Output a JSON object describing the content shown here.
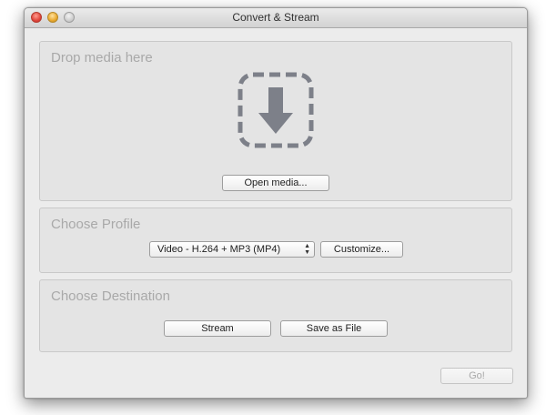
{
  "window": {
    "title": "Convert & Stream"
  },
  "drop_panel": {
    "title": "Drop media here",
    "icon": "download-arrow-icon",
    "open_button": "Open media..."
  },
  "profile_panel": {
    "title": "Choose Profile",
    "selected_profile": "Video - H.264 + MP3 (MP4)",
    "customize_button": "Customize..."
  },
  "destination_panel": {
    "title": "Choose Destination",
    "stream_button": "Stream",
    "save_button": "Save as File"
  },
  "footer": {
    "go_button": "Go!"
  }
}
